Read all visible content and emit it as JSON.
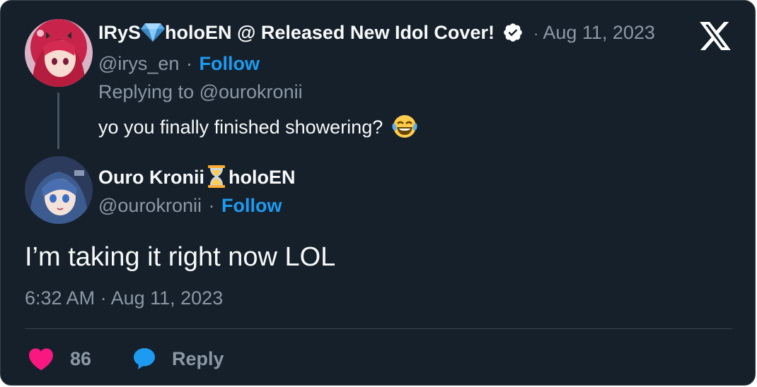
{
  "reply_tweet": {
    "author_name_part1": "IRyS",
    "author_name_part2": "holoEN @ Released New Idol Cover!",
    "handle": "@irys_en",
    "follow_label": "Follow",
    "separator": "·",
    "date": "Aug 11, 2023",
    "replying_to_prefix": "Replying to",
    "replying_to_handle": "@ourokronii",
    "text": "yo you finally finished showering?",
    "verified": true
  },
  "main_tweet": {
    "author_name_part1": "Ouro Kronii",
    "author_name_part2": "holoEN",
    "handle": "@ourokronii",
    "follow_label": "Follow",
    "separator": "·",
    "text": "I’m taking it right now LOL",
    "timestamp": "6:32 AM · Aug 11, 2023"
  },
  "actions": {
    "like_count": "86",
    "reply_label": "Reply"
  },
  "colors": {
    "background": "#15202b",
    "text": "#f7f9f9",
    "muted": "#8b98a5",
    "accent": "#1d9bf0",
    "like": "#f91880"
  },
  "icons": {
    "x_logo": "x-logo-icon",
    "verified": "verified-badge-icon",
    "gem": "gem-emoji-icon",
    "hourglass": "hourglass-emoji-icon",
    "laughing": "tears-of-joy-emoji-icon",
    "heart": "heart-icon",
    "reply": "speech-bubble-icon"
  }
}
